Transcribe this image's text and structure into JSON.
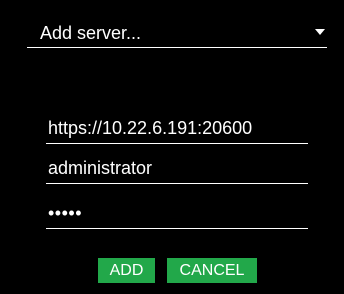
{
  "server_select": {
    "label": "Add server...",
    "icon": "caret-down-icon"
  },
  "form": {
    "url_value": "https://10.22.6.191:20600",
    "username_value": "administrator",
    "password_masked": "•••••"
  },
  "buttons": {
    "add_label": "ADD",
    "cancel_label": "CANCEL"
  },
  "colors": {
    "background": "#000000",
    "text": "#ffffff",
    "button_green": "#22a84a"
  }
}
